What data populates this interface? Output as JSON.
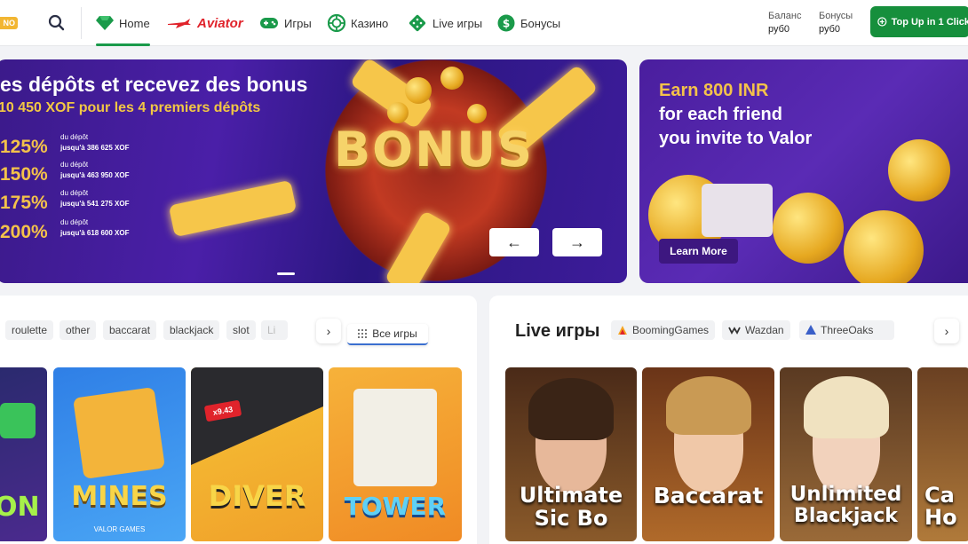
{
  "header": {
    "logo_text": "NO",
    "nav": [
      {
        "label": "Home",
        "icon": "diamond-icon"
      },
      {
        "label": "Aviator",
        "icon": "plane-icon"
      },
      {
        "label": "Игры",
        "icon": "gamepad-icon"
      },
      {
        "label": "Казино",
        "icon": "chip-icon"
      },
      {
        "label": "Live игры",
        "icon": "dice-icon"
      },
      {
        "label": "Бонусы",
        "icon": "dollar-icon"
      }
    ],
    "balance_label": "Баланс",
    "balance_value": "руб0",
    "bonus_label": "Бонусы",
    "bonus_value": "руб0",
    "topup_label": "Top Up in 1 Click"
  },
  "banner_main": {
    "title": "es dépôts et recevez des bonus",
    "subtitle": "10 450 XOF pour les 4 premiers dépôts",
    "tiers": [
      {
        "percent": "125%",
        "line1": "du dépôt",
        "line2": "jusqu'à 386 625 XOF"
      },
      {
        "percent": "150%",
        "line1": "du dépôt",
        "line2": "jusqu'à 463 950 XOF"
      },
      {
        "percent": "175%",
        "line1": "du dépôt",
        "line2": "jusqu'à 541 275 XOF"
      },
      {
        "percent": "200%",
        "line1": "du dépôt",
        "line2": "jusqu'à 618 600 XOF"
      }
    ],
    "bonus_word": "BONUS",
    "prev_arrow": "←",
    "next_arrow": "→"
  },
  "banner_referral": {
    "line1": "Earn 800 INR",
    "line2": "for each friend",
    "line3": "you invite to Valor",
    "button": "Learn More"
  },
  "games": {
    "categories": [
      "roulette",
      "other",
      "baccarat",
      "blackjack",
      "slot",
      "Li"
    ],
    "next": "›",
    "all_games": "Все игры",
    "cards": [
      {
        "title": "ON",
        "caption": ""
      },
      {
        "title": "MINES",
        "caption": "VALOR GAMES"
      },
      {
        "title": "DIVER",
        "caption": "",
        "badge": "x9.43"
      },
      {
        "title": "TOWER",
        "caption": ""
      }
    ]
  },
  "live": {
    "heading": "Live игры",
    "providers": [
      "BoomingGames",
      "Wazdan",
      "ThreeOaks"
    ],
    "next": "›",
    "cards": [
      {
        "title1": "Ultimate",
        "title2": "Sic Bo"
      },
      {
        "title1": "Baccarat",
        "title2": ""
      },
      {
        "title1": "Unlimited",
        "title2": "Blackjack"
      },
      {
        "title1": "Ca",
        "title2": "Ho"
      }
    ]
  },
  "colors": {
    "accent": "#168f3c",
    "banner_purple": "#4a1fa8",
    "gold": "#f4c24a"
  }
}
